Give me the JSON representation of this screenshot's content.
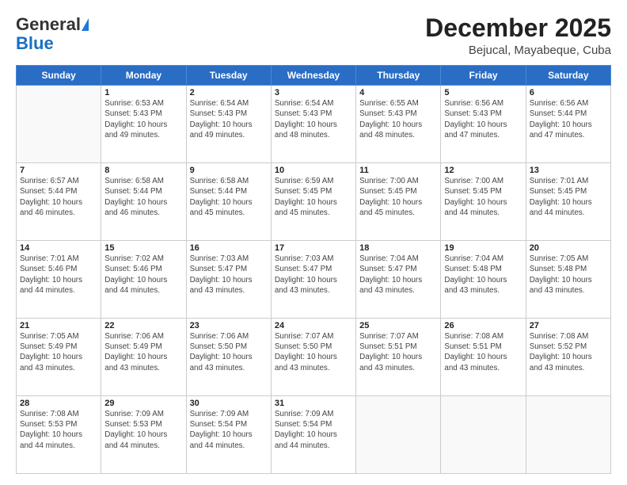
{
  "header": {
    "logo_line1": "General",
    "logo_line2": "Blue",
    "month_title": "December 2025",
    "location": "Bejucal, Mayabeque, Cuba"
  },
  "weekdays": [
    "Sunday",
    "Monday",
    "Tuesday",
    "Wednesday",
    "Thursday",
    "Friday",
    "Saturday"
  ],
  "weeks": [
    [
      {
        "day": "",
        "info": ""
      },
      {
        "day": "1",
        "info": "Sunrise: 6:53 AM\nSunset: 5:43 PM\nDaylight: 10 hours\nand 49 minutes."
      },
      {
        "day": "2",
        "info": "Sunrise: 6:54 AM\nSunset: 5:43 PM\nDaylight: 10 hours\nand 49 minutes."
      },
      {
        "day": "3",
        "info": "Sunrise: 6:54 AM\nSunset: 5:43 PM\nDaylight: 10 hours\nand 48 minutes."
      },
      {
        "day": "4",
        "info": "Sunrise: 6:55 AM\nSunset: 5:43 PM\nDaylight: 10 hours\nand 48 minutes."
      },
      {
        "day": "5",
        "info": "Sunrise: 6:56 AM\nSunset: 5:43 PM\nDaylight: 10 hours\nand 47 minutes."
      },
      {
        "day": "6",
        "info": "Sunrise: 6:56 AM\nSunset: 5:44 PM\nDaylight: 10 hours\nand 47 minutes."
      }
    ],
    [
      {
        "day": "7",
        "info": "Sunrise: 6:57 AM\nSunset: 5:44 PM\nDaylight: 10 hours\nand 46 minutes."
      },
      {
        "day": "8",
        "info": "Sunrise: 6:58 AM\nSunset: 5:44 PM\nDaylight: 10 hours\nand 46 minutes."
      },
      {
        "day": "9",
        "info": "Sunrise: 6:58 AM\nSunset: 5:44 PM\nDaylight: 10 hours\nand 45 minutes."
      },
      {
        "day": "10",
        "info": "Sunrise: 6:59 AM\nSunset: 5:45 PM\nDaylight: 10 hours\nand 45 minutes."
      },
      {
        "day": "11",
        "info": "Sunrise: 7:00 AM\nSunset: 5:45 PM\nDaylight: 10 hours\nand 45 minutes."
      },
      {
        "day": "12",
        "info": "Sunrise: 7:00 AM\nSunset: 5:45 PM\nDaylight: 10 hours\nand 44 minutes."
      },
      {
        "day": "13",
        "info": "Sunrise: 7:01 AM\nSunset: 5:45 PM\nDaylight: 10 hours\nand 44 minutes."
      }
    ],
    [
      {
        "day": "14",
        "info": "Sunrise: 7:01 AM\nSunset: 5:46 PM\nDaylight: 10 hours\nand 44 minutes."
      },
      {
        "day": "15",
        "info": "Sunrise: 7:02 AM\nSunset: 5:46 PM\nDaylight: 10 hours\nand 44 minutes."
      },
      {
        "day": "16",
        "info": "Sunrise: 7:03 AM\nSunset: 5:47 PM\nDaylight: 10 hours\nand 43 minutes."
      },
      {
        "day": "17",
        "info": "Sunrise: 7:03 AM\nSunset: 5:47 PM\nDaylight: 10 hours\nand 43 minutes."
      },
      {
        "day": "18",
        "info": "Sunrise: 7:04 AM\nSunset: 5:47 PM\nDaylight: 10 hours\nand 43 minutes."
      },
      {
        "day": "19",
        "info": "Sunrise: 7:04 AM\nSunset: 5:48 PM\nDaylight: 10 hours\nand 43 minutes."
      },
      {
        "day": "20",
        "info": "Sunrise: 7:05 AM\nSunset: 5:48 PM\nDaylight: 10 hours\nand 43 minutes."
      }
    ],
    [
      {
        "day": "21",
        "info": "Sunrise: 7:05 AM\nSunset: 5:49 PM\nDaylight: 10 hours\nand 43 minutes."
      },
      {
        "day": "22",
        "info": "Sunrise: 7:06 AM\nSunset: 5:49 PM\nDaylight: 10 hours\nand 43 minutes."
      },
      {
        "day": "23",
        "info": "Sunrise: 7:06 AM\nSunset: 5:50 PM\nDaylight: 10 hours\nand 43 minutes."
      },
      {
        "day": "24",
        "info": "Sunrise: 7:07 AM\nSunset: 5:50 PM\nDaylight: 10 hours\nand 43 minutes."
      },
      {
        "day": "25",
        "info": "Sunrise: 7:07 AM\nSunset: 5:51 PM\nDaylight: 10 hours\nand 43 minutes."
      },
      {
        "day": "26",
        "info": "Sunrise: 7:08 AM\nSunset: 5:51 PM\nDaylight: 10 hours\nand 43 minutes."
      },
      {
        "day": "27",
        "info": "Sunrise: 7:08 AM\nSunset: 5:52 PM\nDaylight: 10 hours\nand 43 minutes."
      }
    ],
    [
      {
        "day": "28",
        "info": "Sunrise: 7:08 AM\nSunset: 5:53 PM\nDaylight: 10 hours\nand 44 minutes."
      },
      {
        "day": "29",
        "info": "Sunrise: 7:09 AM\nSunset: 5:53 PM\nDaylight: 10 hours\nand 44 minutes."
      },
      {
        "day": "30",
        "info": "Sunrise: 7:09 AM\nSunset: 5:54 PM\nDaylight: 10 hours\nand 44 minutes."
      },
      {
        "day": "31",
        "info": "Sunrise: 7:09 AM\nSunset: 5:54 PM\nDaylight: 10 hours\nand 44 minutes."
      },
      {
        "day": "",
        "info": ""
      },
      {
        "day": "",
        "info": ""
      },
      {
        "day": "",
        "info": ""
      }
    ]
  ]
}
